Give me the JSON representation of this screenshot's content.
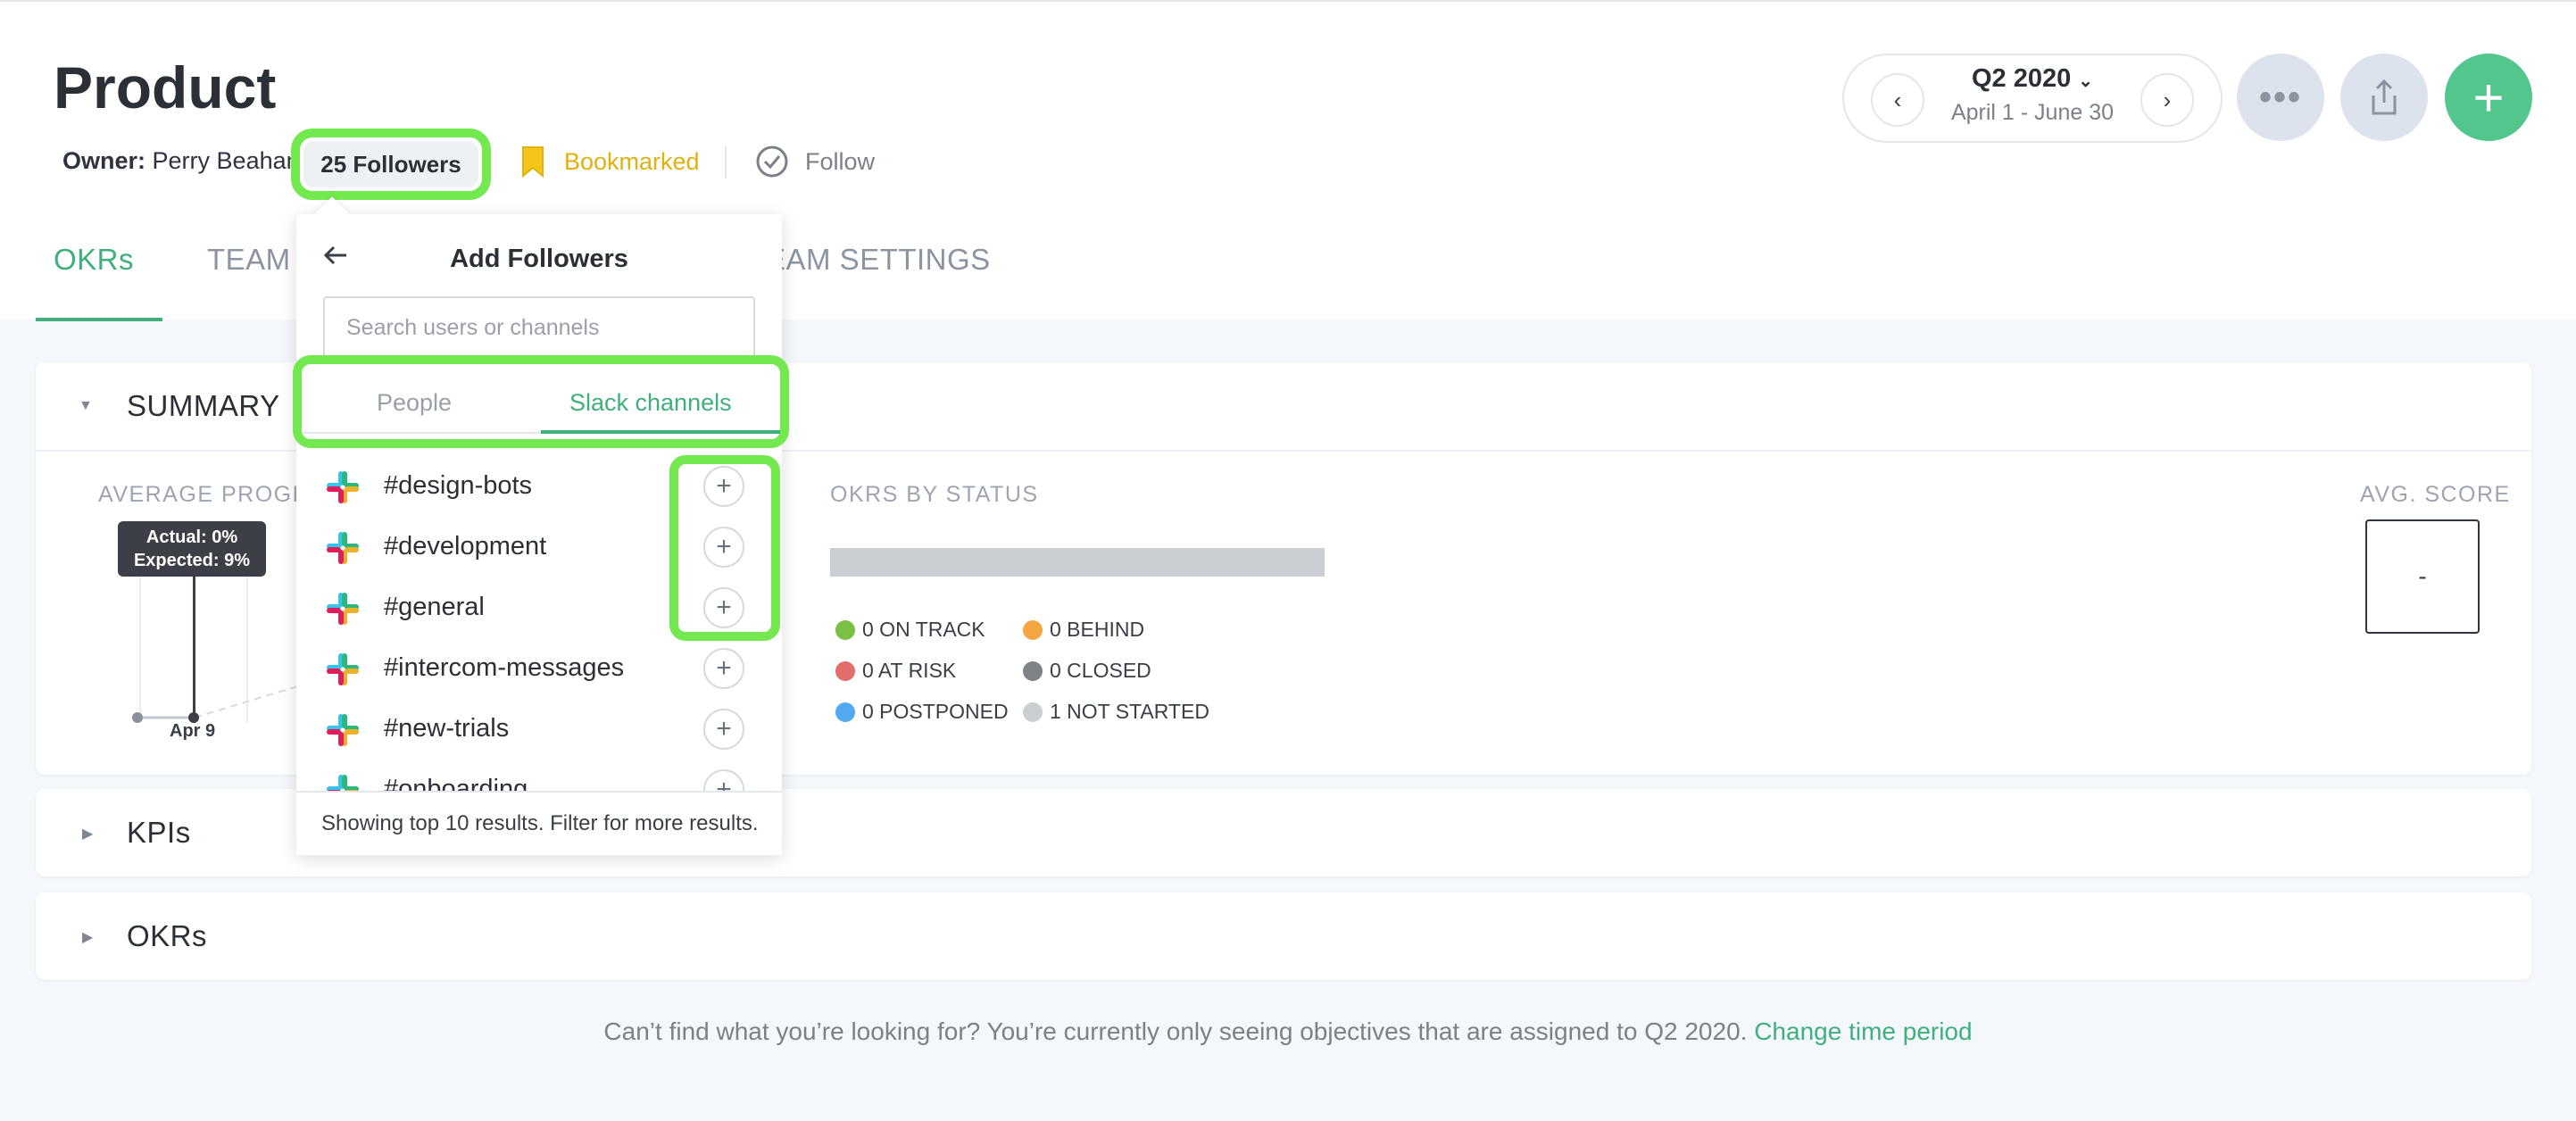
{
  "page": {
    "title": "Product",
    "owner_label": "Owner:",
    "owner_name": "Perry Beahan",
    "followers_label": "25 Followers",
    "bookmarked_label": "Bookmarked",
    "follow_label": "Follow"
  },
  "period": {
    "title": "Q2 2020",
    "range": "April 1 - June 30",
    "prev_icon": "chevron-left-icon",
    "next_icon": "chevron-right-icon"
  },
  "tabs": [
    {
      "label": "OKRs"
    },
    {
      "label": "TEAM"
    },
    {
      "label": "EAM SETTINGS"
    }
  ],
  "summary": {
    "title": "SUMMARY",
    "average_progress_label": "AVERAGE PROGR",
    "tooltip_actual": "Actual: 0%",
    "tooltip_expected": "Expected: 9%",
    "date_label": "Apr 9",
    "okrs_by_status_label": "OKRS BY STATUS",
    "avg_score_label": "AVG. SCORE",
    "avg_score_value": "-",
    "status": [
      {
        "label": "0 ON TRACK",
        "color": "#7ac143"
      },
      {
        "label": "0 BEHIND",
        "color": "#f4a640"
      },
      {
        "label": "0 AT RISK",
        "color": "#e16d6d"
      },
      {
        "label": "0 CLOSED",
        "color": "#7f8389"
      },
      {
        "label": "0 POSTPONED",
        "color": "#52a9ef"
      },
      {
        "label": "1 NOT STARTED",
        "color": "#cbced3"
      }
    ]
  },
  "sections": {
    "kpis_title": "KPIs",
    "okrs_title": "OKRs"
  },
  "popover": {
    "title": "Add Followers",
    "search_placeholder": "Search users or channels",
    "tab_people": "People",
    "tab_slack": "Slack channels",
    "channels": [
      {
        "name": "#design-bots"
      },
      {
        "name": "#development"
      },
      {
        "name": "#general"
      },
      {
        "name": "#intercom-messages"
      },
      {
        "name": "#new-trials"
      },
      {
        "name": "#onboarding"
      }
    ],
    "footer": "Showing top 10 results. Filter for more results."
  },
  "bottom_note": {
    "text": "Can’t find what you’re looking for? You’re currently only seeing objectives that are assigned to Q2 2020.",
    "link": "Change time period"
  },
  "colors": {
    "accent": "#3fb07c",
    "highlight": "#73e84f",
    "bookmark": "#e0b20f"
  }
}
